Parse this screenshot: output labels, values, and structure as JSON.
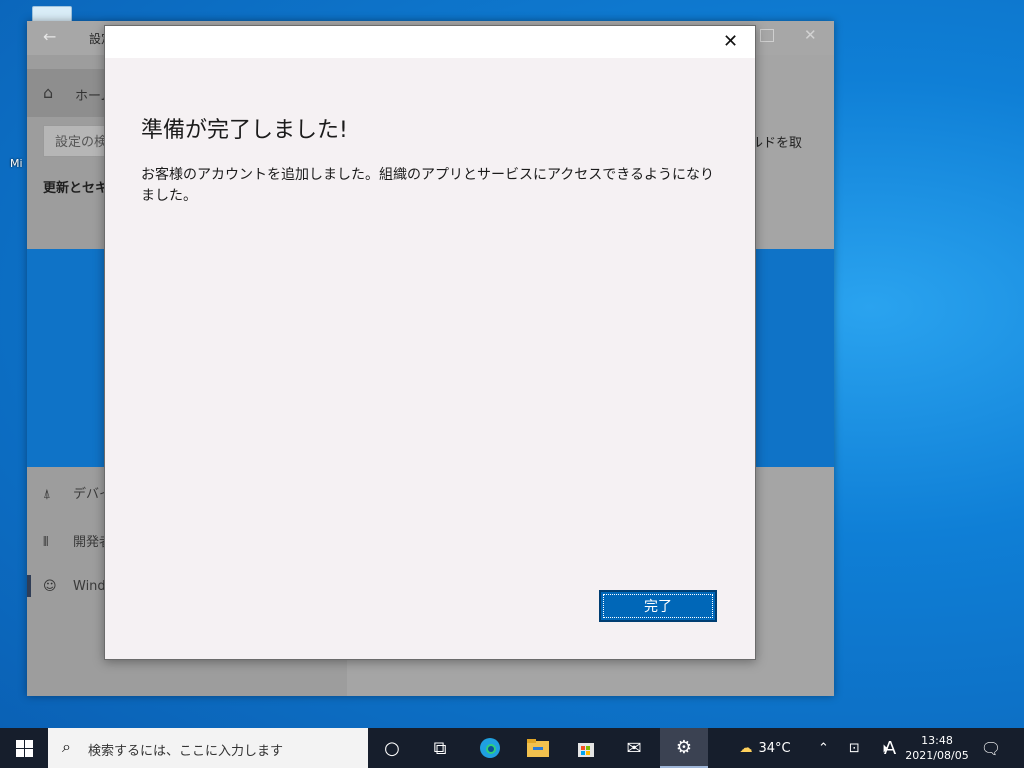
{
  "desktop": {
    "icon_label": "Mi"
  },
  "settings_window": {
    "title": "設定",
    "back_glyph": "←",
    "close_glyph": "✕",
    "home_label": "ホーム",
    "search_placeholder": "設定の検",
    "section_title": "更新とセキ",
    "right_text": "ルドを取",
    "nav_items": [
      {
        "label": "デバイ",
        "icon": "device-icon"
      },
      {
        "label": "開発者",
        "icon": "developer-icon"
      },
      {
        "label": "Wind",
        "icon": "windows-insider-icon"
      }
    ]
  },
  "dialog": {
    "close_glyph": "✕",
    "heading": "準備が完了しました!",
    "message": "お客様のアカウントを追加しました。組織のアプリとサービスにアクセスできるようになりました。",
    "done_button": "完了",
    "accent_color": "#0067b8"
  },
  "taskbar": {
    "search_placeholder": "検索するには、ここに入力します",
    "weather_temp": "34°C",
    "ime_indicator": "A",
    "time": "13:48",
    "date": "2021/08/05",
    "background_color": "#161e2c"
  }
}
